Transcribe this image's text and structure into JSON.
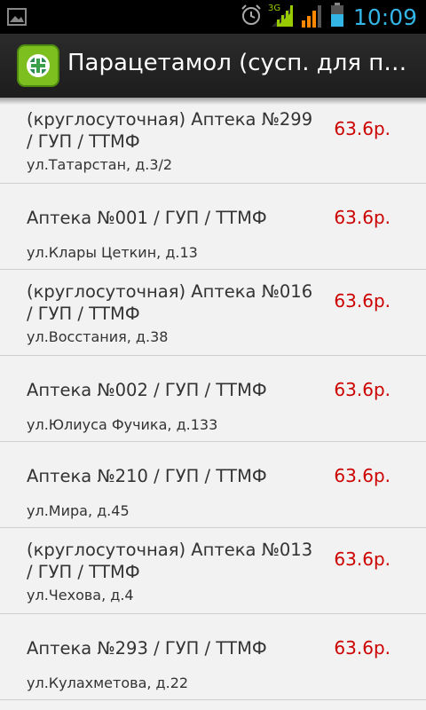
{
  "status_bar": {
    "time": "10:09",
    "network": "3G"
  },
  "action_bar": {
    "title": "Парацетамол (сусп. для при..."
  },
  "pharmacies": [
    {
      "name": "(круглосуточная) Аптека №299 / ГУП / ТТМФ",
      "address": "ул.Татарстан, д.3/2",
      "price": "63.6р."
    },
    {
      "name": "Аптека №001 / ГУП / ТТМФ",
      "address": "ул.Клары Цеткин, д.13",
      "price": "63.6р."
    },
    {
      "name": "(круглосуточная) Аптека №016 / ГУП / ТТМФ",
      "address": "ул.Восстания, д.38",
      "price": "63.6р."
    },
    {
      "name": "Аптека №002 / ГУП / ТТМФ",
      "address": "ул.Юлиуса Фучика, д.133",
      "price": "63.6р."
    },
    {
      "name": "Аптека №210 / ГУП / ТТМФ",
      "address": "ул.Мира, д.45",
      "price": "63.6р."
    },
    {
      "name": "(круглосуточная) Аптека №013 / ГУП / ТТМФ",
      "address": "ул.Чехова, д.4",
      "price": "63.6р."
    },
    {
      "name": "Аптека №293 / ГУП / ТТМФ",
      "address": "ул.Кулахметова, д.22",
      "price": "63.6р."
    }
  ],
  "colors": {
    "price": "#cc0000",
    "time": "#33b5e5",
    "signal": "#99cc00",
    "battery": "#33b5e5"
  }
}
